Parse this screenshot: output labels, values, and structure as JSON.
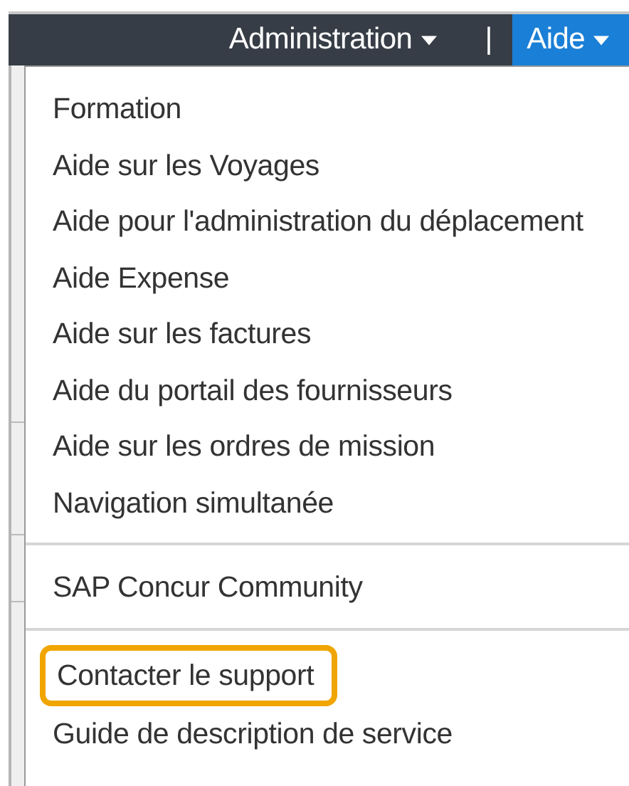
{
  "nav": {
    "items": [
      {
        "label": "Administration",
        "kind": "dropdown",
        "selected": false
      },
      {
        "label": "|",
        "kind": "separator"
      },
      {
        "label": "Aide",
        "kind": "dropdown",
        "selected": true
      }
    ]
  },
  "menu": {
    "sections": [
      {
        "items": [
          {
            "label": "Formation",
            "highlighted": false
          },
          {
            "label": "Aide sur les Voyages",
            "highlighted": false
          },
          {
            "label": "Aide pour l'administration du déplacement",
            "highlighted": false
          },
          {
            "label": "Aide Expense",
            "highlighted": false
          },
          {
            "label": "Aide sur les factures",
            "highlighted": false
          },
          {
            "label": "Aide du portail des fournisseurs",
            "highlighted": false
          },
          {
            "label": "Aide sur les ordres de mission",
            "highlighted": false
          },
          {
            "label": "Navigation simultanée",
            "highlighted": false
          }
        ]
      },
      {
        "items": [
          {
            "label": "SAP Concur Community",
            "highlighted": false
          }
        ]
      },
      {
        "items": [
          {
            "label": "Contacter le support",
            "highlighted": true
          },
          {
            "label": "Guide de description de service",
            "highlighted": false
          }
        ]
      }
    ]
  }
}
